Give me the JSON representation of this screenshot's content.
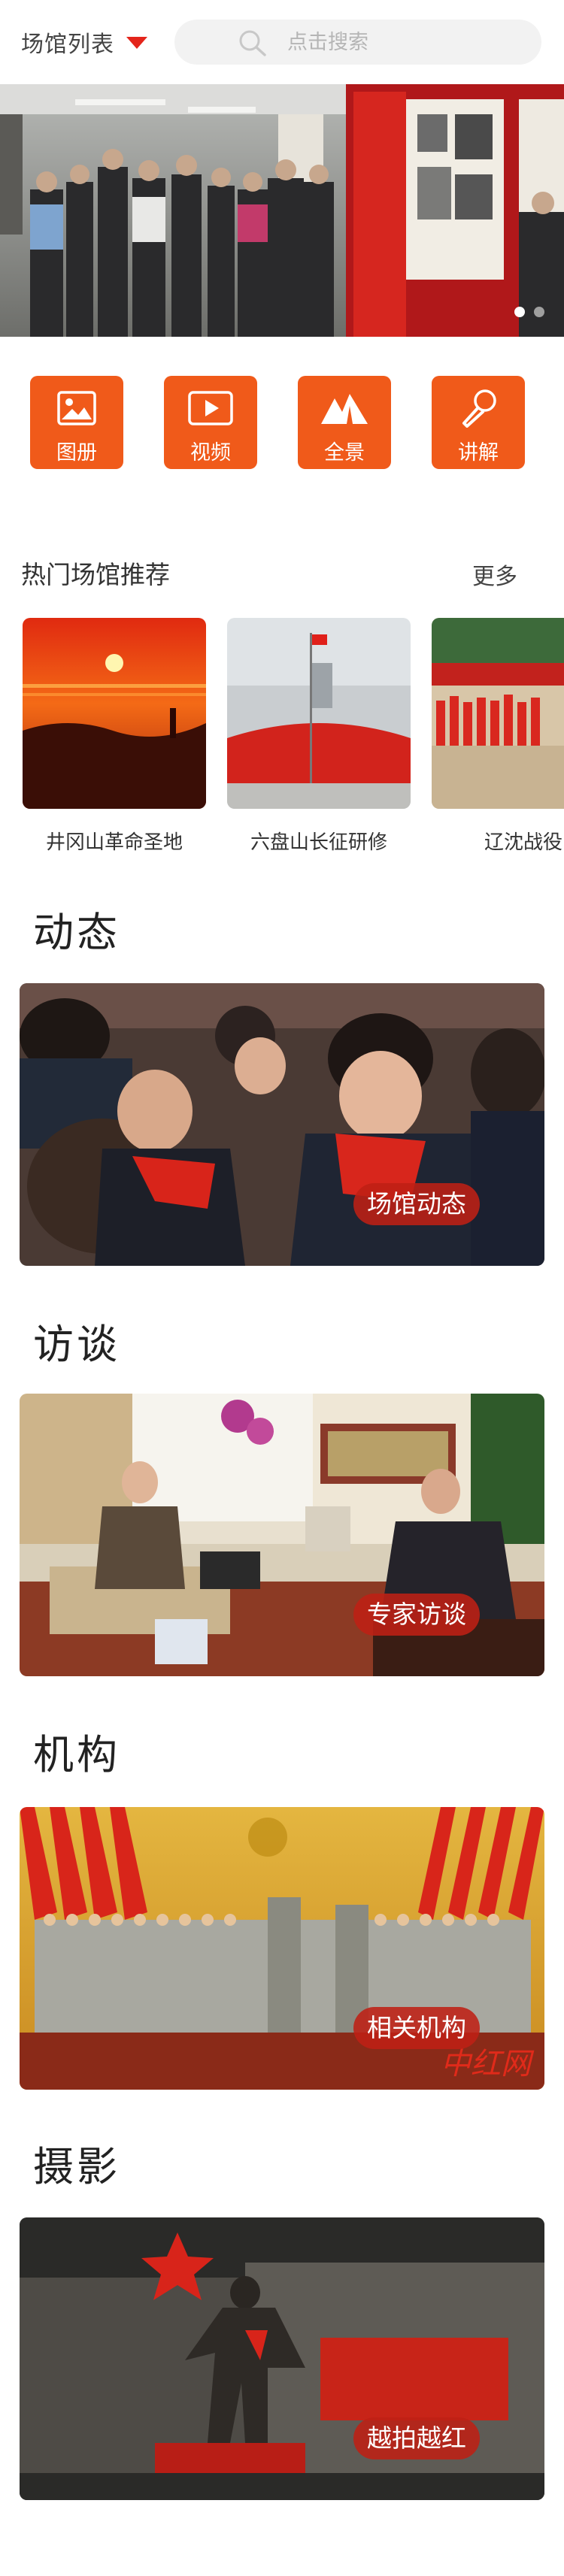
{
  "header": {
    "venue_label": "场馆列表",
    "search_placeholder": "点击搜索",
    "accent": "#e4251b"
  },
  "banner": {
    "slides": 2,
    "active_slide": 1
  },
  "quicknav": [
    {
      "label": "图册",
      "icon": "photo-icon"
    },
    {
      "label": "视频",
      "icon": "video-play-icon"
    },
    {
      "label": "全景",
      "icon": "mountain-panorama-icon"
    },
    {
      "label": "讲解",
      "icon": "microphone-icon"
    }
  ],
  "hot_venues": {
    "title": "热门场馆推荐",
    "more": "更多",
    "items": [
      {
        "name": "井冈山革命圣地"
      },
      {
        "name": "六盘山长征研修"
      },
      {
        "name": "辽沈战役"
      }
    ]
  },
  "categories": [
    {
      "title": "动态",
      "tag": "场馆动态"
    },
    {
      "title": "访谈",
      "tag": "专家访谈"
    },
    {
      "title": "机构",
      "tag": "相关机构"
    },
    {
      "title": "摄影",
      "tag": "越拍越红"
    }
  ],
  "colors": {
    "brand_orange": "#f05a1a",
    "tag_red": "#be2014"
  }
}
